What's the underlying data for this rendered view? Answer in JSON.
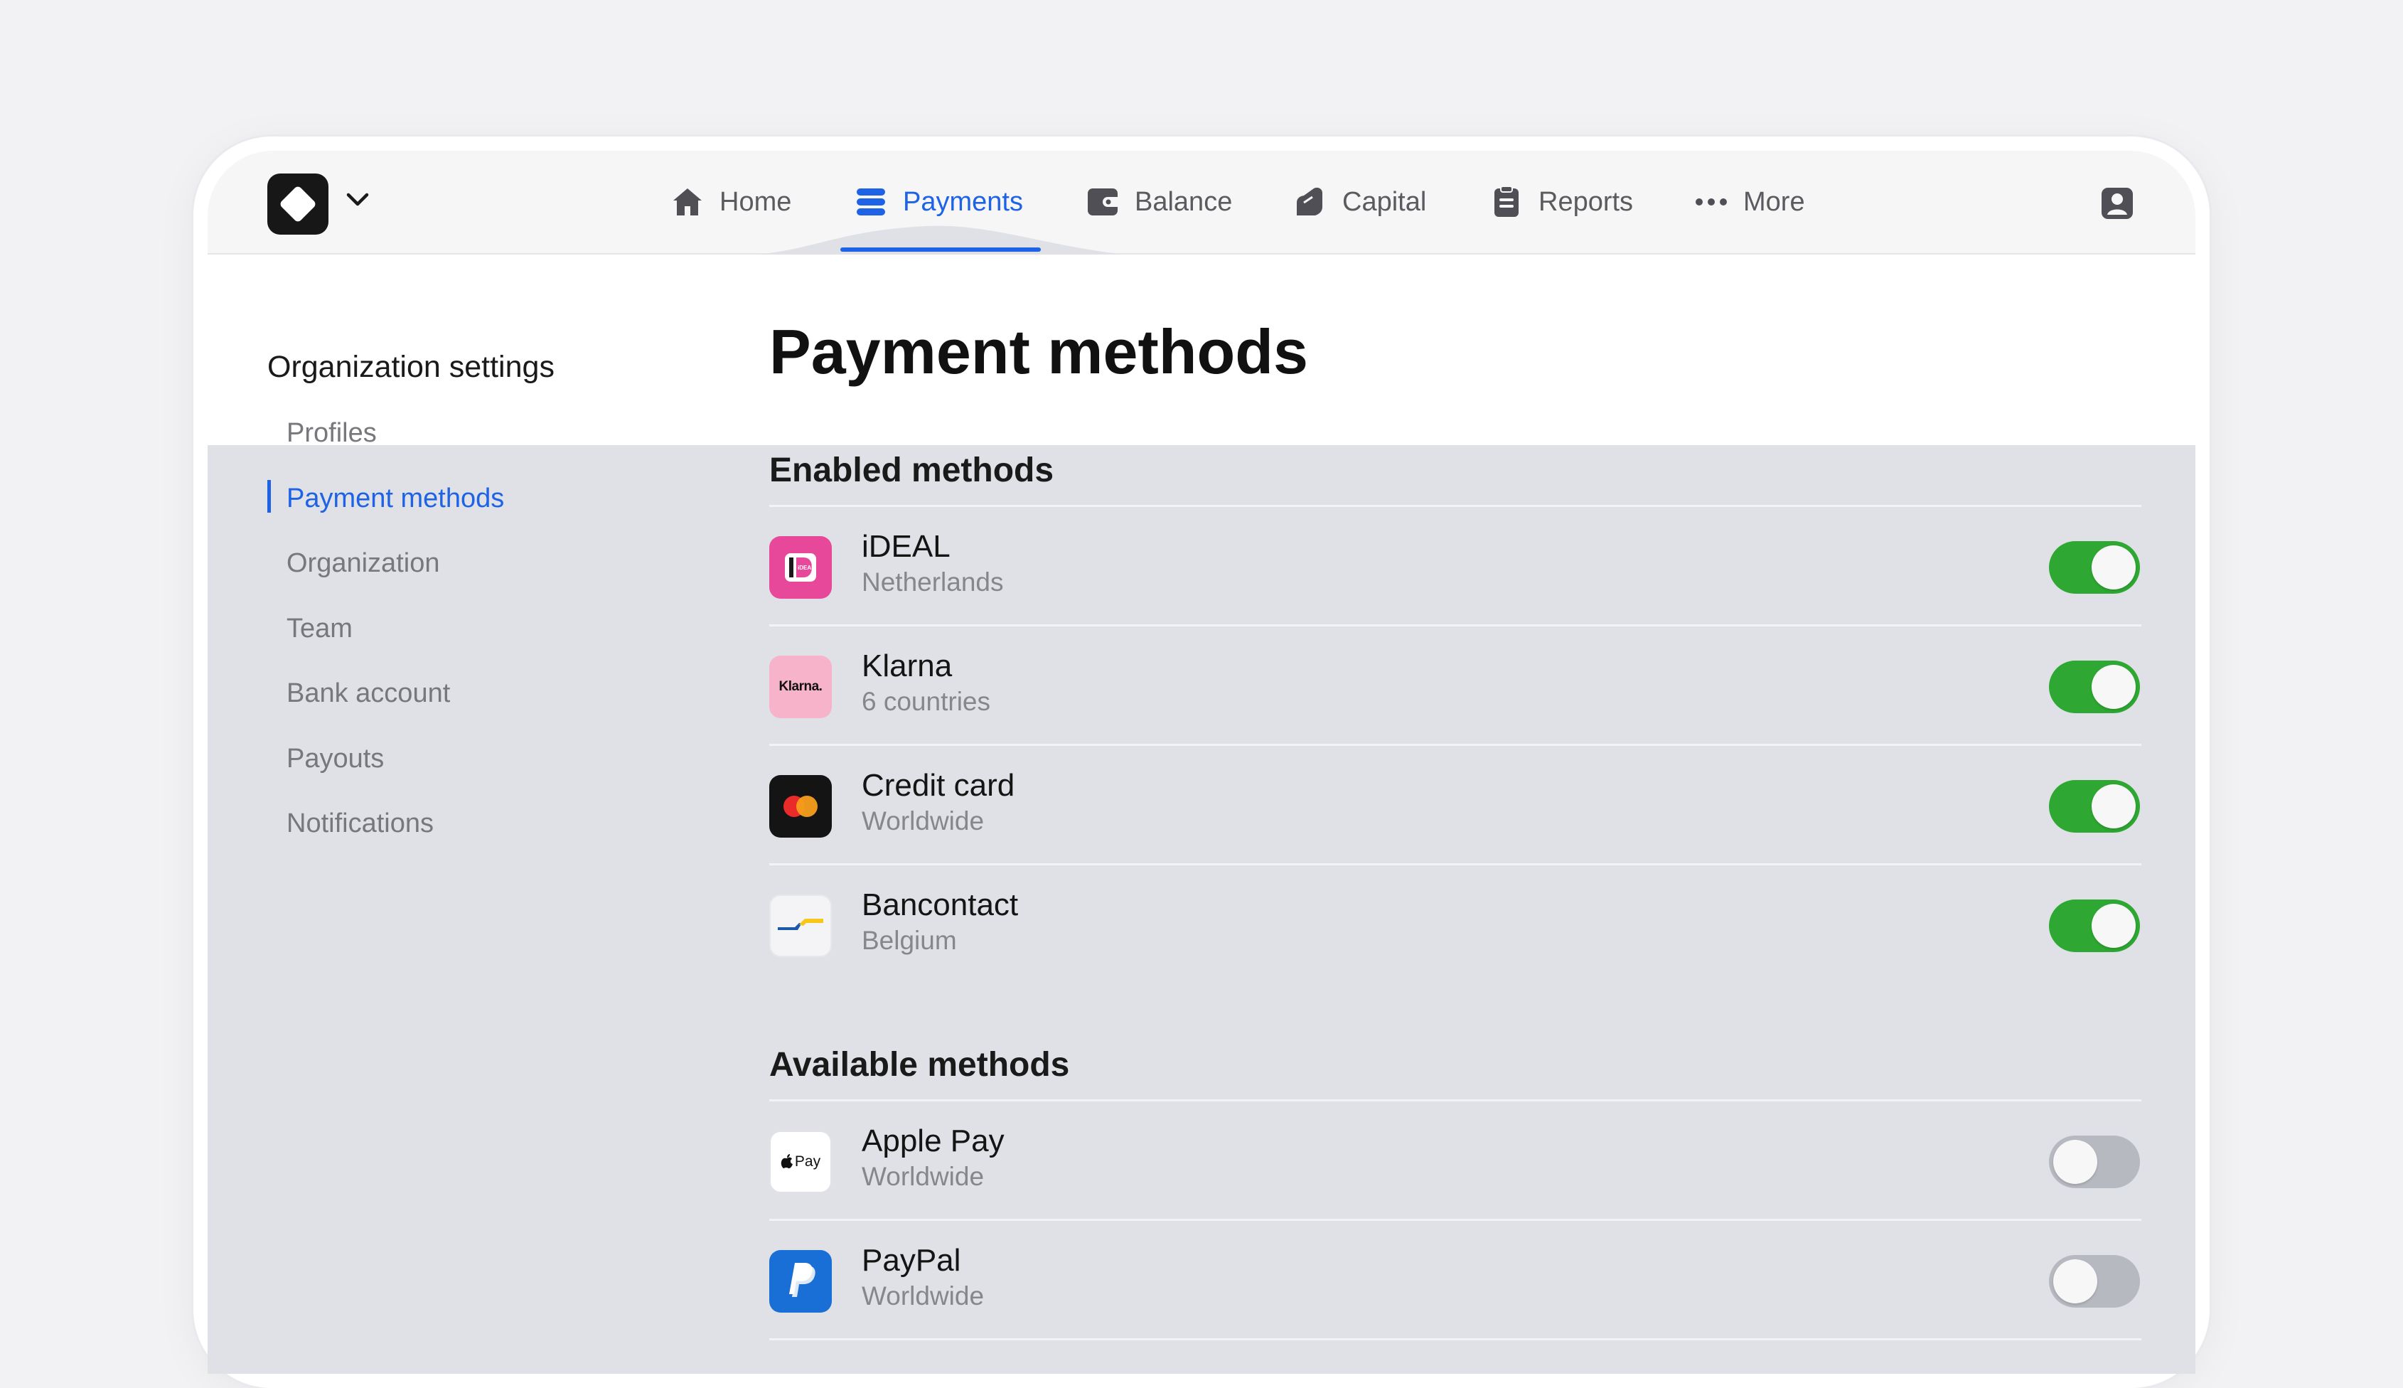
{
  "nav": {
    "items": [
      {
        "label": "Home",
        "icon": "home-icon"
      },
      {
        "label": "Payments",
        "icon": "payments-icon",
        "active": true
      },
      {
        "label": "Balance",
        "icon": "wallet-icon"
      },
      {
        "label": "Capital",
        "icon": "capital-icon"
      },
      {
        "label": "Reports",
        "icon": "clipboard-icon"
      },
      {
        "label": "More",
        "icon": "more-dots-icon"
      }
    ]
  },
  "sidebar": {
    "title": "Organization settings",
    "items": [
      {
        "label": "Profiles"
      },
      {
        "label": "Payment methods",
        "active": true
      },
      {
        "label": "Organization"
      },
      {
        "label": "Team"
      },
      {
        "label": "Bank account"
      },
      {
        "label": "Payouts"
      },
      {
        "label": "Notifications"
      }
    ]
  },
  "page": {
    "title": "Payment methods",
    "enabled_title": "Enabled methods",
    "available_title": "Available methods"
  },
  "enabled": [
    {
      "name": "iDEAL",
      "sub": "Netherlands",
      "icon": "ideal-icon",
      "enabled": true
    },
    {
      "name": "Klarna",
      "sub": "6 countries",
      "icon": "klarna-icon",
      "icon_text": "Klarna.",
      "enabled": true
    },
    {
      "name": "Credit card",
      "sub": "Worldwide",
      "icon": "mastercard-icon",
      "enabled": true
    },
    {
      "name": "Bancontact",
      "sub": "Belgium",
      "icon": "bancontact-icon",
      "enabled": true
    }
  ],
  "available": [
    {
      "name": "Apple Pay",
      "sub": "Worldwide",
      "icon": "apple-pay-icon",
      "icon_text": "Pay",
      "enabled": false
    },
    {
      "name": "PayPal",
      "sub": "Worldwide",
      "icon": "paypal-icon",
      "enabled": false
    }
  ],
  "colors": {
    "accent": "#1e62e6",
    "toggle_on": "#2ea832",
    "toggle_off": "#b7b9c0"
  }
}
